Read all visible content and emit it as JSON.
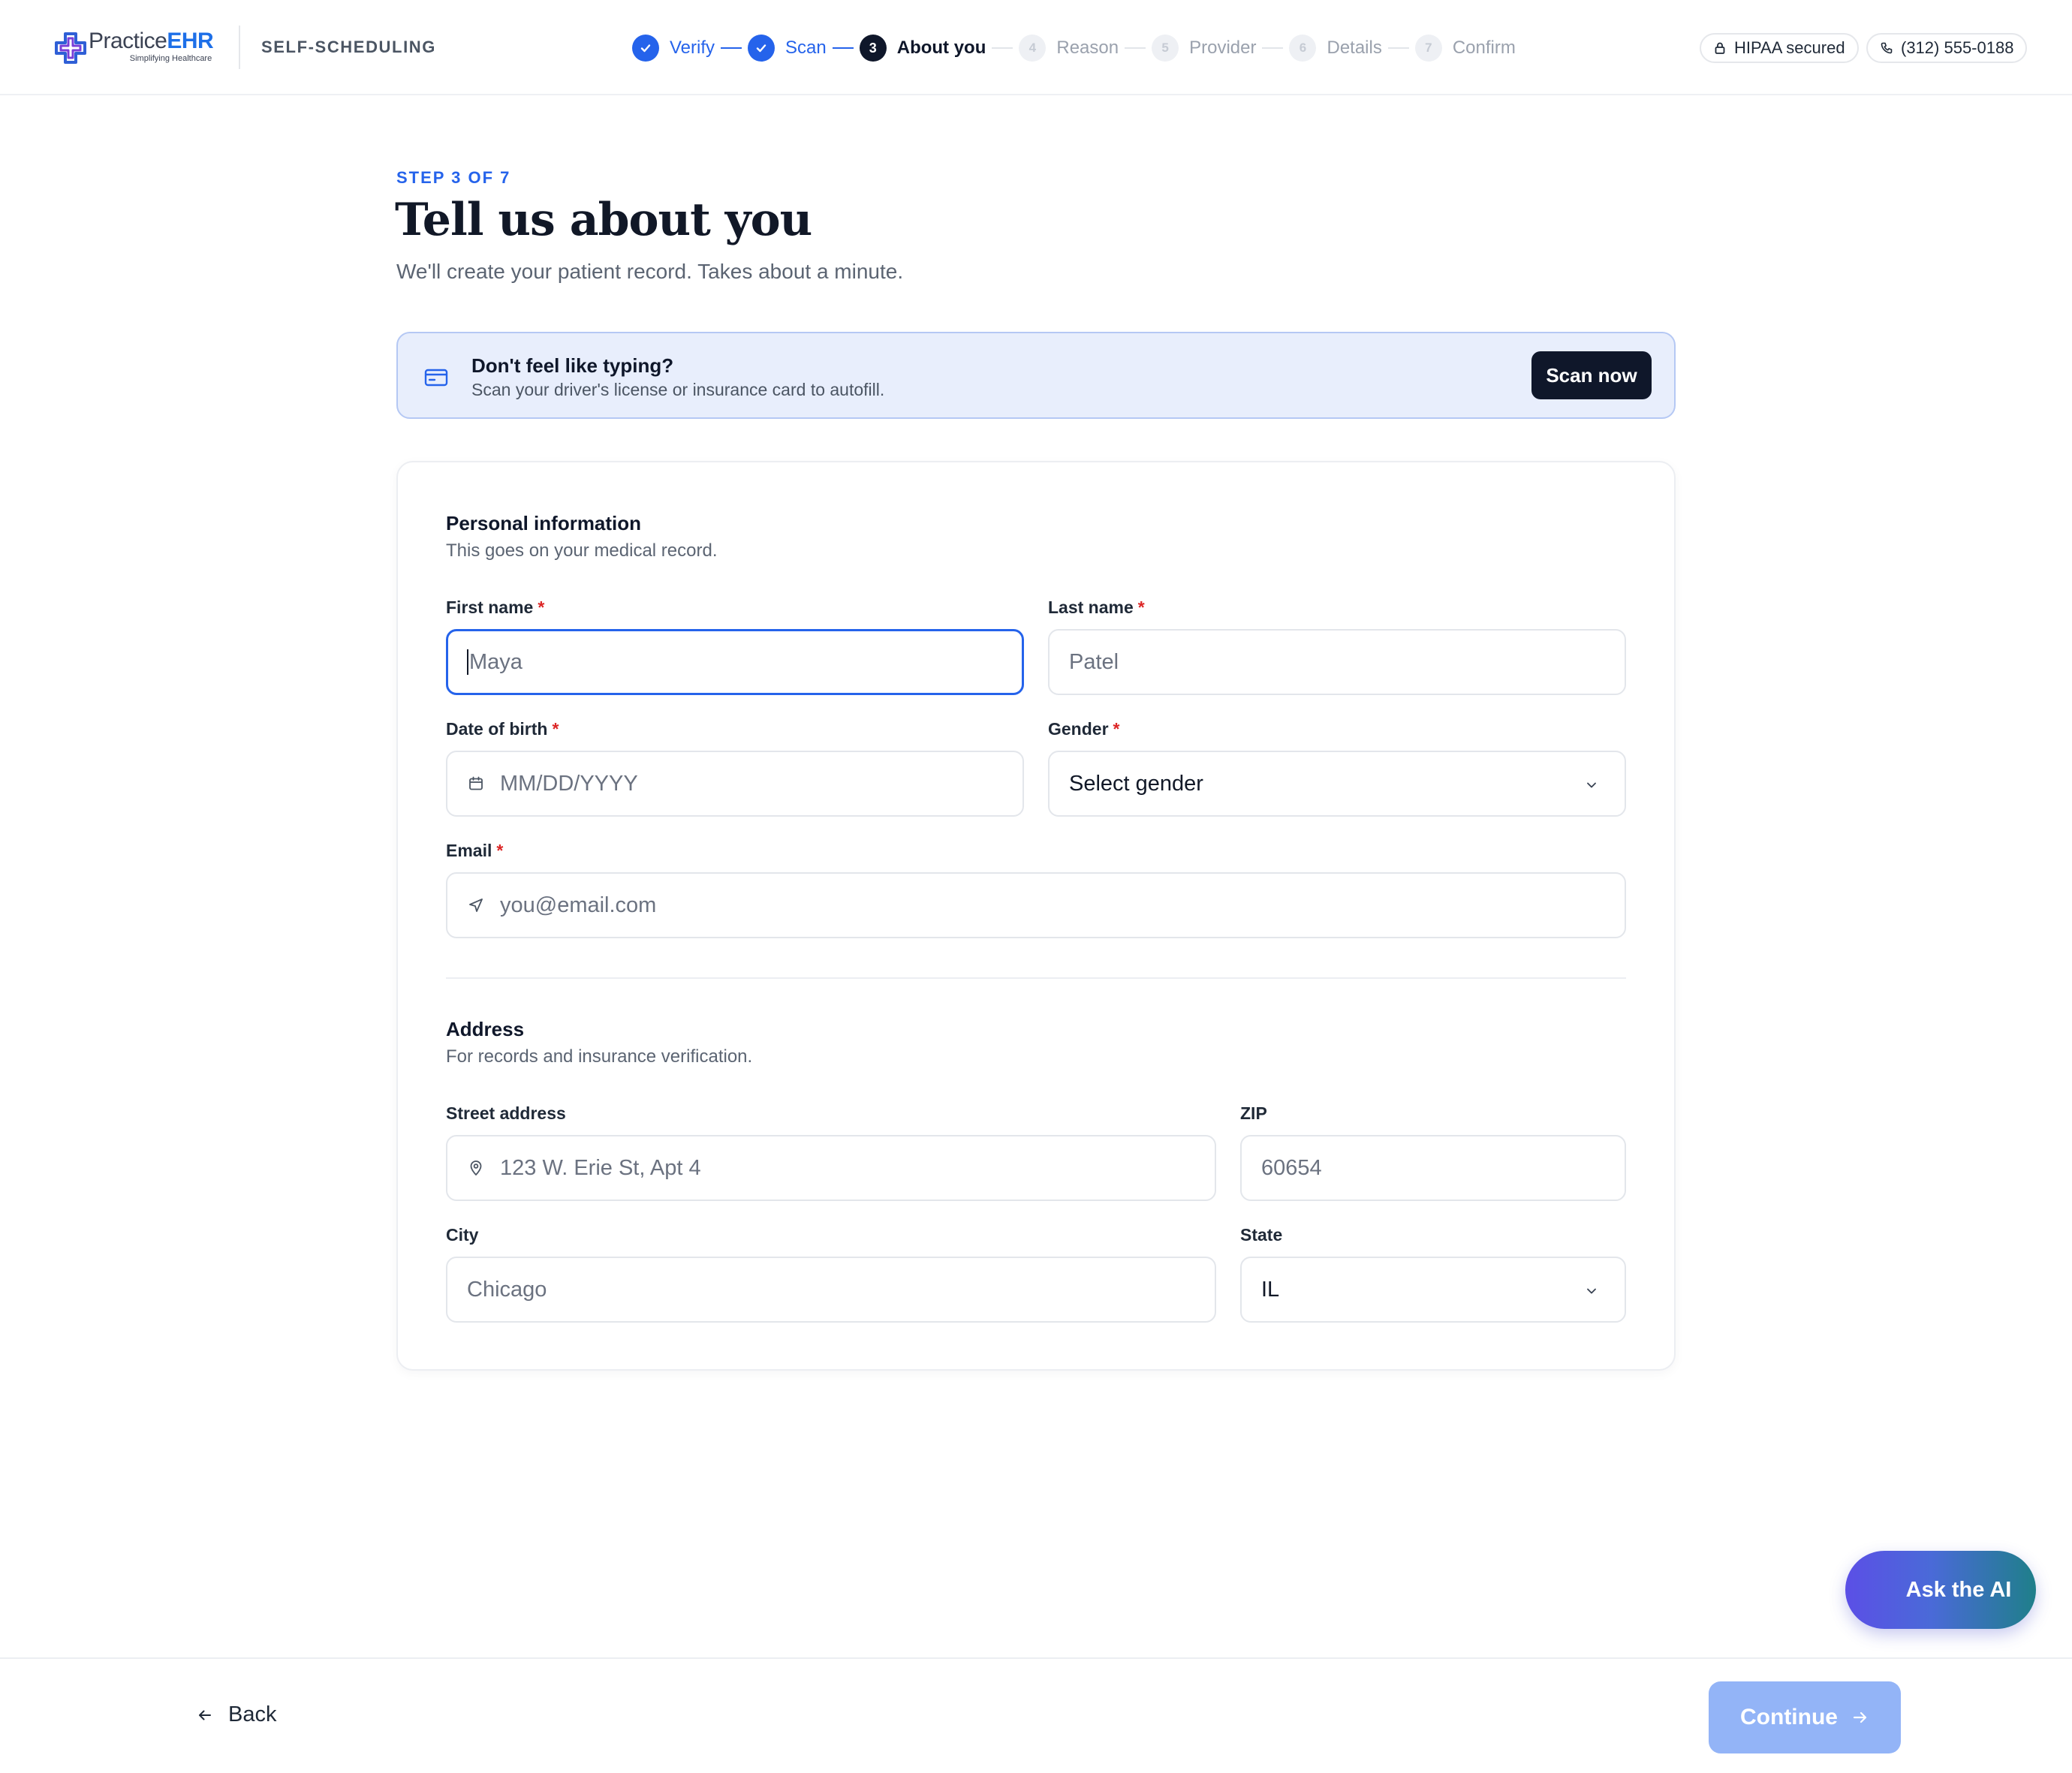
{
  "brand": {
    "name_a": "Practice",
    "name_b": "EHR",
    "tagline": "Simplifying Healthcare",
    "app_label": "SELF-SCHEDULING"
  },
  "stepper": [
    {
      "num": "1",
      "label": "Verify",
      "state": "done"
    },
    {
      "num": "2",
      "label": "Scan",
      "state": "done"
    },
    {
      "num": "3",
      "label": "About you",
      "state": "current"
    },
    {
      "num": "4",
      "label": "Reason",
      "state": "todo"
    },
    {
      "num": "5",
      "label": "Provider",
      "state": "todo"
    },
    {
      "num": "6",
      "label": "Details",
      "state": "todo"
    },
    {
      "num": "7",
      "label": "Confirm",
      "state": "todo"
    }
  ],
  "header": {
    "hipaa": "HIPAA secured",
    "phone": "(312) 555-0188"
  },
  "page": {
    "eyebrow": "STEP 3 OF 7",
    "title": "Tell us about you",
    "subtitle": "We'll create your patient record. Takes about a minute."
  },
  "banner": {
    "title": "Don't feel like typing?",
    "text": "Scan your driver's license or insurance card to autofill.",
    "button": "Scan now"
  },
  "personal": {
    "title": "Personal information",
    "subtitle": "This goes on your medical record.",
    "first_name": {
      "label": "First name",
      "placeholder": "Maya"
    },
    "last_name": {
      "label": "Last name",
      "placeholder": "Patel"
    },
    "dob": {
      "label": "Date of birth",
      "placeholder": "MM/DD/YYYY"
    },
    "gender": {
      "label": "Gender",
      "value": "Select gender"
    },
    "email": {
      "label": "Email",
      "placeholder": "you@email.com"
    },
    "required_mark": "*"
  },
  "address": {
    "title": "Address",
    "subtitle": "For records and insurance verification.",
    "street": {
      "label": "Street address",
      "placeholder": "123 W. Erie St, Apt 4"
    },
    "zip": {
      "label": "ZIP",
      "placeholder": "60654"
    },
    "city": {
      "label": "City",
      "placeholder": "Chicago"
    },
    "state": {
      "label": "State",
      "value": "IL"
    }
  },
  "assistant": {
    "label": "Ask the AI"
  },
  "footer": {
    "back": "Back",
    "continue": "Continue"
  },
  "colors": {
    "primary": "#2563eb",
    "dark": "#0f172a",
    "banner_bg": "#e8eefc",
    "continue_disabled": "#93b4f7",
    "required": "#dc2626"
  }
}
